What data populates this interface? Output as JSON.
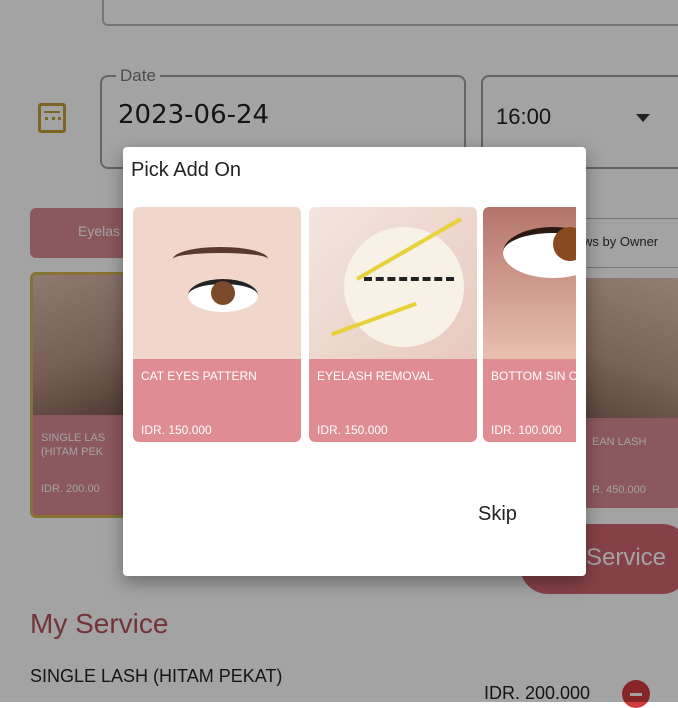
{
  "background": {
    "date_label": "Date",
    "date_value": "2023-06-24",
    "time_value": "16:00",
    "category_left": "Eyelas",
    "category_right": "ws by Owner",
    "card_left": {
      "name": "SINGLE LAS\n(HITAM PEK",
      "price": "IDR. 200.00"
    },
    "card_right": {
      "name": "EAN LASH",
      "price": "R. 450.000"
    },
    "add_service_label": "Service",
    "my_service_title": "My Service",
    "service_item": {
      "name": "SINGLE LASH (HITAM PEKAT)",
      "price": "IDR. 200.000"
    }
  },
  "dialog": {
    "title": "Pick Add On",
    "items": [
      {
        "name": "CAT EYES PATTERN",
        "price": "IDR. 150.000"
      },
      {
        "name": "EYELASH REMOVAL",
        "price": "IDR. 150.000"
      },
      {
        "name": "BOTTOM SIN on)",
        "price": "IDR. 100.000"
      }
    ],
    "skip_label": "Skip"
  }
}
